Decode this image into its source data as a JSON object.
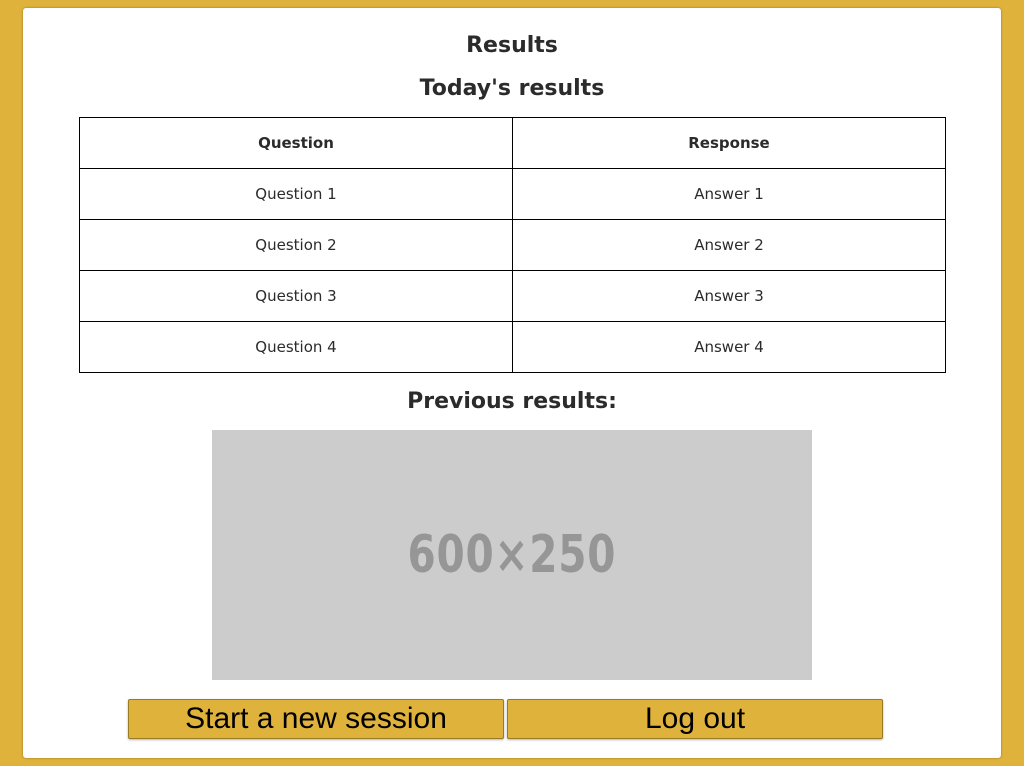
{
  "page": {
    "title": "Results",
    "todays_heading": "Today's results",
    "previous_heading": "Previous results:"
  },
  "table": {
    "headers": [
      "Question",
      "Response"
    ],
    "rows": [
      [
        "Question 1",
        "Answer 1"
      ],
      [
        "Question 2",
        "Answer 2"
      ],
      [
        "Question 3",
        "Answer 3"
      ],
      [
        "Question 4",
        "Answer 4"
      ]
    ]
  },
  "previous_results_image": {
    "placeholder_text": "600×250"
  },
  "buttons": {
    "new_session": "Start a new session",
    "logout": "Log out"
  },
  "colors": {
    "background": "#dfb23b",
    "button": "#dfb23b",
    "placeholder": "#cccccc"
  }
}
